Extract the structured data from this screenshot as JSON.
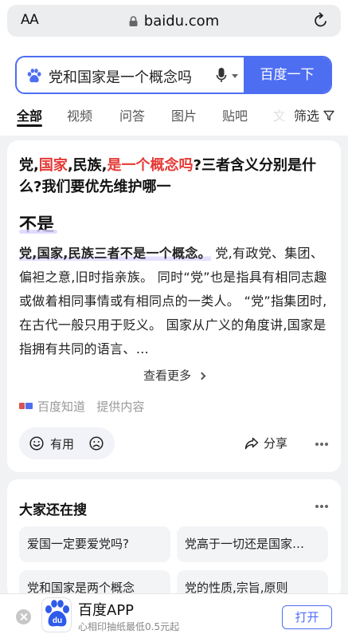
{
  "browser": {
    "text_size_label": "AA",
    "domain": "baidu.com"
  },
  "search": {
    "query": "党和国家是一个概念吗",
    "button_label": "百度一下"
  },
  "tabs": [
    "全部",
    "视频",
    "问答",
    "图片",
    "贴吧",
    "文"
  ],
  "filter_label": "筛选",
  "result": {
    "title_parts": [
      "党,",
      "国家",
      ",民族,",
      "是一个概念吗",
      "?三者含义分别是什么?我们要优先维护哪一"
    ],
    "answer": "不是",
    "body_bold": "党,国家,民族三者不是一个概念。",
    "body_text": "党,有政党、集团、偏袒之意,旧时指亲族。 同时“党”也是指具有相同志趣或做着相同事情或有相同点的一类人。 “党”指集团时,在古代一般只用于贬义。 国家从广义的角度讲,国家是指拥有共同的语言、…",
    "more_label": "查看更多",
    "source_name": "百度知道",
    "source_suffix": "提供内容",
    "useful_label": "有用",
    "share_label": "分享"
  },
  "related": {
    "title": "大家还在搜",
    "items": [
      "爱国一定要爱党吗?",
      "党高于一切还是国家…",
      "党和国家是两个概念",
      "党的性质,宗旨,原则"
    ]
  },
  "app_banner": {
    "name": "百度APP",
    "desc": "心相印抽纸最低0.5元起",
    "open_label": "打开",
    "icon_text": "du"
  },
  "colors": {
    "brand_blue": "#4e6ef2",
    "highlight_red": "#e53935"
  }
}
